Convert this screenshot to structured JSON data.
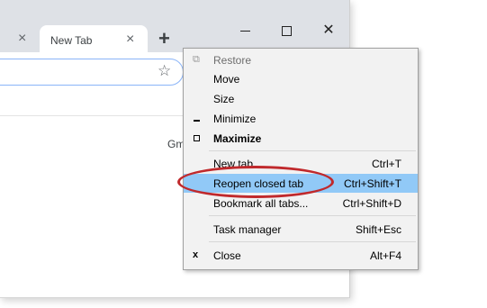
{
  "browser": {
    "tabs": [
      {
        "label": "",
        "close_icon": "×"
      },
      {
        "label": "New Tab",
        "close_icon": "×",
        "active": true
      }
    ],
    "new_tab_icon": "+",
    "window_controls": {
      "close": "✕"
    },
    "star_icon": "☆",
    "page_link": "Gm"
  },
  "menu": {
    "items": [
      {
        "label": "Restore",
        "shortcut": "",
        "icon": "restore-icon",
        "disabled": true
      },
      {
        "label": "Move",
        "shortcut": ""
      },
      {
        "label": "Size",
        "shortcut": ""
      },
      {
        "label": "Minimize",
        "shortcut": "",
        "icon": "minimize-icon"
      },
      {
        "label": "Maximize",
        "shortcut": "",
        "icon": "maximize-icon",
        "bold": true
      },
      {
        "label": "New tab",
        "shortcut": "Ctrl+T"
      },
      {
        "label": "Reopen closed tab",
        "shortcut": "Ctrl+Shift+T",
        "highlighted": true
      },
      {
        "label": "Bookmark all tabs...",
        "shortcut": "Ctrl+Shift+D"
      },
      {
        "label": "Task manager",
        "shortcut": "Shift+Esc"
      },
      {
        "label": "Close",
        "shortcut": "Alt+F4",
        "icon": "close-icon"
      }
    ]
  },
  "colors": {
    "highlight": "#91c9f7",
    "annotation": "#c0292c",
    "titlebar": "#dee1e6"
  }
}
